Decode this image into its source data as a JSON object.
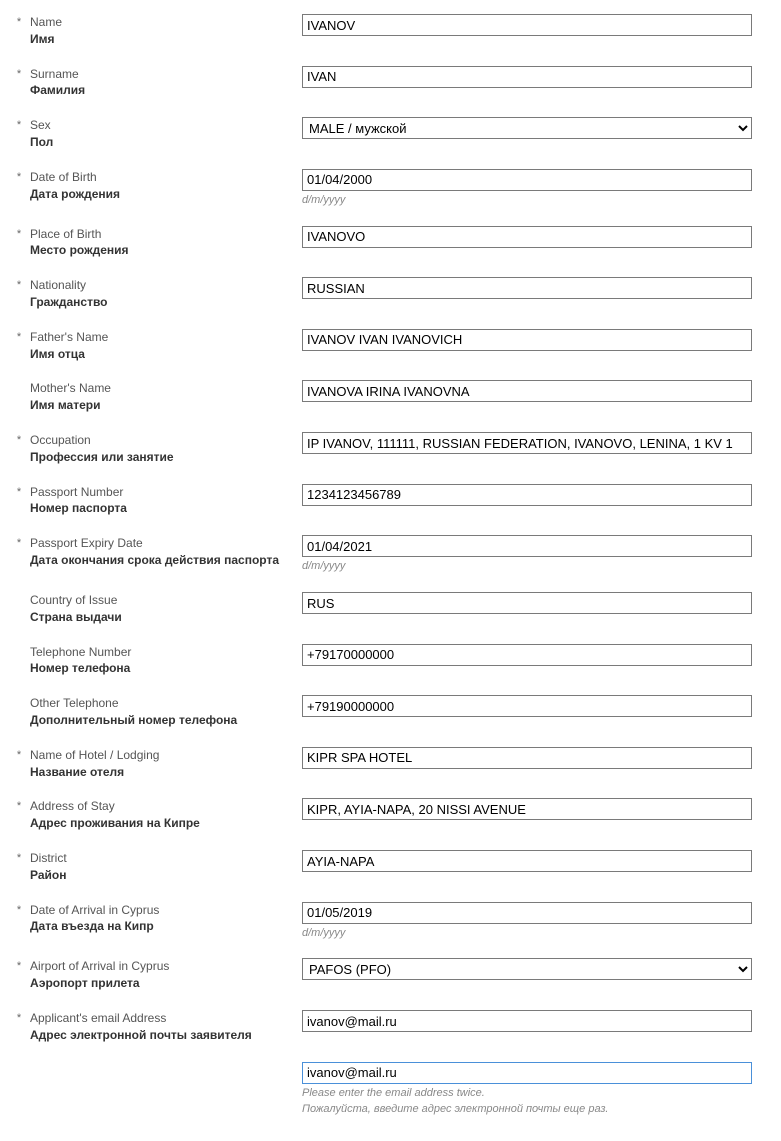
{
  "hints": {
    "date_format": "d/m/yyyy",
    "email_twice_en": "Please enter the email address twice.",
    "email_twice_ru": "Пожалуйста, введите адрес электронной почты еще раз."
  },
  "selects": {
    "sex": "MALE / мужской",
    "airport": "PAFOS (PFO)"
  },
  "fields": [
    {
      "key": "name",
      "req": true,
      "en": "Name",
      "ru": "Имя",
      "type": "text",
      "value": "IVANOV"
    },
    {
      "key": "surname",
      "req": true,
      "en": "Surname",
      "ru": "Фамилия",
      "type": "text",
      "value": "IVAN"
    },
    {
      "key": "sex",
      "req": true,
      "en": "Sex",
      "ru": "Пол",
      "type": "select",
      "select_key": "sex"
    },
    {
      "key": "dob",
      "req": true,
      "en": "Date of Birth",
      "ru": "Дата рождения",
      "type": "text",
      "value": "01/04/2000",
      "hint": "date_format"
    },
    {
      "key": "pob",
      "req": true,
      "en": "Place of Birth",
      "ru": "Место рождения",
      "type": "text",
      "value": "IVANOVO"
    },
    {
      "key": "nationality",
      "req": true,
      "en": "Nationality",
      "ru": "Гражданство",
      "type": "text",
      "value": "RUSSIAN"
    },
    {
      "key": "father",
      "req": true,
      "en": "Father's Name",
      "ru": "Имя отца",
      "type": "text",
      "value": "IVANOV IVAN IVANOVICH"
    },
    {
      "key": "mother",
      "req": false,
      "en": "Mother's Name",
      "ru": "Имя матери",
      "type": "text",
      "value": "IVANOVA IRINA IVANOVNA"
    },
    {
      "key": "occupation",
      "req": true,
      "en": "Occupation",
      "ru": "Профессия или занятие",
      "type": "text",
      "value": "IP IVANOV, 111111, RUSSIAN FEDERATION, IVANOVO, LENINA, 1 KV 1"
    },
    {
      "key": "passport_no",
      "req": true,
      "en": "Passport Number",
      "ru": "Номер паспорта",
      "type": "text",
      "value": "1234123456789"
    },
    {
      "key": "passport_exp",
      "req": true,
      "en": "Passport Expiry Date",
      "ru": "Дата окончания срока действия паспорта",
      "type": "text",
      "value": "01/04/2021",
      "hint": "date_format"
    },
    {
      "key": "country_issue",
      "req": false,
      "en": "Country of Issue",
      "ru": "Страна выдачи",
      "type": "text",
      "value": "RUS"
    },
    {
      "key": "telephone",
      "req": false,
      "en": "Telephone Number",
      "ru": "Номер телефона",
      "type": "text",
      "value": "+79170000000"
    },
    {
      "key": "other_phone",
      "req": false,
      "en": "Other Telephone",
      "ru": "Дополнительный номер телефона",
      "type": "text",
      "value": "+79190000000"
    },
    {
      "key": "hotel",
      "req": true,
      "en": "Name of Hotel / Lodging",
      "ru": "Название отеля",
      "type": "text",
      "value": "KIPR SPA HOTEL"
    },
    {
      "key": "address_stay",
      "req": true,
      "en": "Address of Stay",
      "ru": "Адрес проживания на Кипре",
      "type": "text",
      "value": "KIPR, AYIA-NAPA, 20 NISSI AVENUE"
    },
    {
      "key": "district",
      "req": true,
      "en": "District",
      "ru": "Район",
      "type": "text",
      "value": "AYIA-NAPA"
    },
    {
      "key": "arrival_date",
      "req": true,
      "en": "Date of Arrival in Cyprus",
      "ru": "Дата въезда на Кипр",
      "type": "text",
      "value": "01/05/2019",
      "hint": "date_format"
    },
    {
      "key": "airport",
      "req": true,
      "en": "Airport of Arrival in Cyprus",
      "ru": "Аэропорт прилета",
      "type": "select",
      "select_key": "airport"
    },
    {
      "key": "email",
      "req": true,
      "en": "Applicant's email Address",
      "ru": "Адрес электронной почты заявителя",
      "type": "text",
      "value": "ivanov@mail.ru"
    }
  ],
  "email_confirm": {
    "value": "ivanov@mail.ru"
  }
}
